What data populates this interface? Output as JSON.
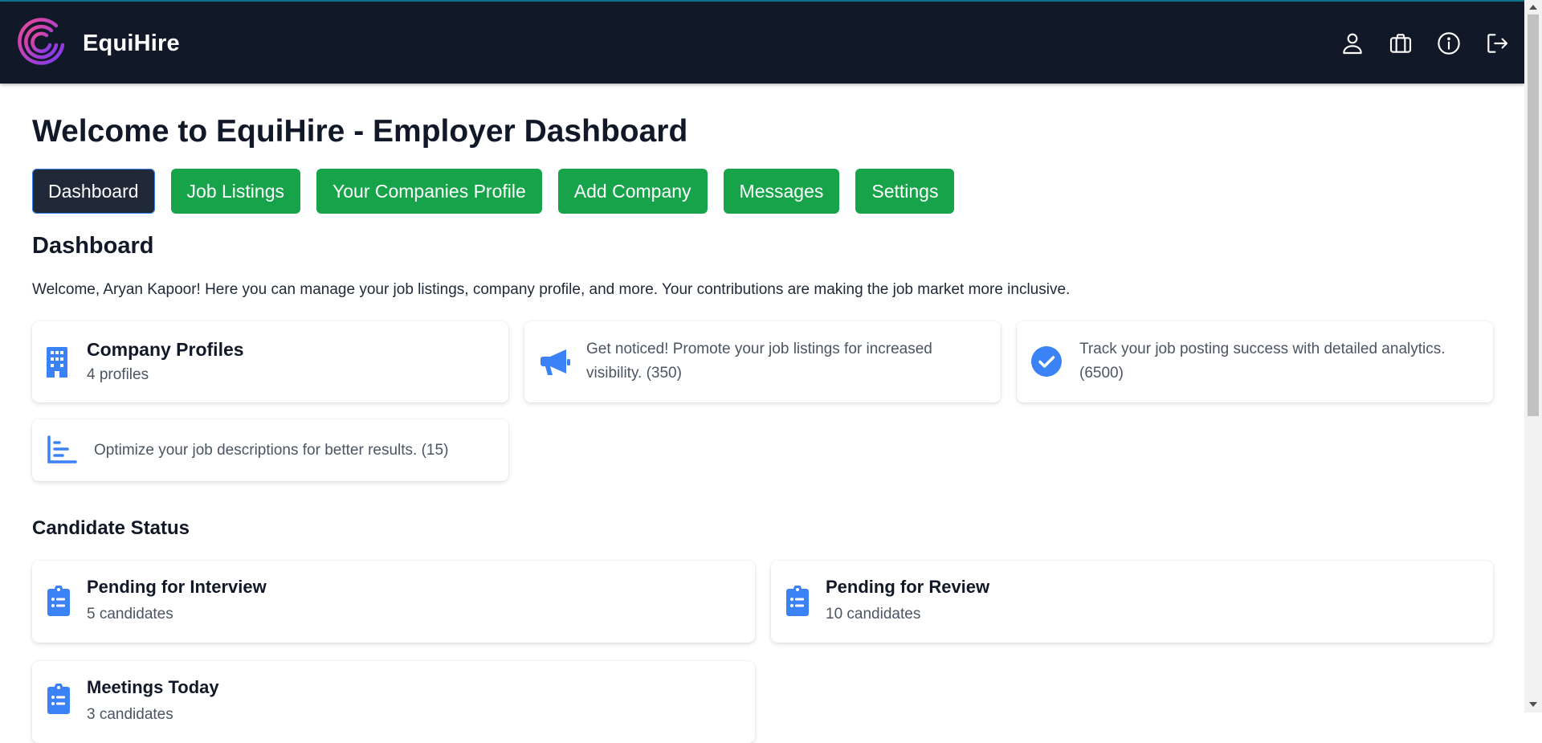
{
  "navbar": {
    "brand": "EquiHire",
    "icons": [
      "user-icon",
      "briefcase-icon",
      "info-icon",
      "logout-icon"
    ]
  },
  "page": {
    "title": "Welcome to EquiHire - Employer Dashboard"
  },
  "tabs": [
    {
      "label": "Dashboard",
      "active": true
    },
    {
      "label": "Job Listings",
      "active": false
    },
    {
      "label": "Your Companies Profile",
      "active": false
    },
    {
      "label": "Add Company",
      "active": false
    },
    {
      "label": "Messages",
      "active": false
    },
    {
      "label": "Settings",
      "active": false
    }
  ],
  "dashboard": {
    "heading": "Dashboard",
    "welcome": "Welcome, Aryan Kapoor! Here you can manage your job listings, company profile, and more. Your contributions are making the job market more inclusive.",
    "cards": [
      {
        "icon": "building-icon",
        "title": "Company Profiles",
        "sub": "4 profiles"
      },
      {
        "icon": "megaphone-icon",
        "text": "Get noticed! Promote your job listings for increased visibility. (350)"
      },
      {
        "icon": "check-circle-icon",
        "text": "Track your job posting success with detailed analytics. (6500)"
      },
      {
        "icon": "chart-bar-icon",
        "text": "Optimize your job descriptions for better results. (15)"
      }
    ]
  },
  "candidate_status": {
    "heading": "Candidate Status",
    "cards": [
      {
        "icon": "clipboard-list-icon",
        "title": "Pending for Interview",
        "sub": "5 candidates"
      },
      {
        "icon": "clipboard-list-icon",
        "title": "Pending for Review",
        "sub": "10 candidates"
      },
      {
        "icon": "clipboard-list-icon",
        "title": "Meetings Today",
        "sub": "3 candidates"
      }
    ]
  },
  "colors": {
    "navbar": "#111827",
    "tab": "#16a34a",
    "tab_active": "#1f2937",
    "icon": "#3b82f6"
  }
}
